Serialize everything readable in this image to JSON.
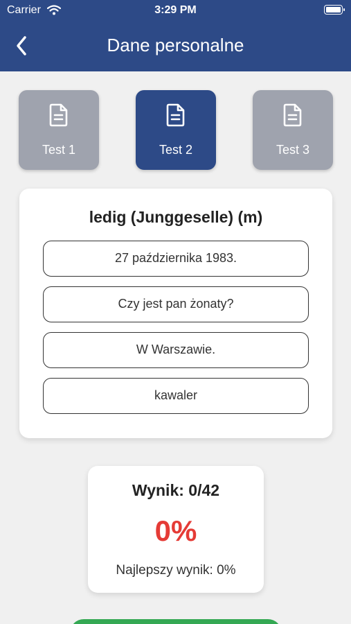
{
  "status_bar": {
    "carrier": "Carrier",
    "time": "3:29 PM"
  },
  "header": {
    "title": "Dane personalne",
    "back_icon": "chevron-left-icon"
  },
  "tabs": [
    {
      "label": "Test 1",
      "icon": "document-icon",
      "active": false
    },
    {
      "label": "Test 2",
      "icon": "document-icon",
      "active": true
    },
    {
      "label": "Test 3",
      "icon": "document-icon",
      "active": false
    }
  ],
  "quiz": {
    "question": "ledig (Junggeselle) (m)",
    "answers": [
      "27 października 1983.",
      "Czy jest pan żonaty?",
      "W Warszawie.",
      "kawaler"
    ]
  },
  "score": {
    "title": "Wynik: 0/42",
    "percent": "0%",
    "best": "Najlepszy wynik: 0%"
  },
  "colors": {
    "primary": "#2d4a87",
    "inactive_tab": "#9fa3ae",
    "score_red": "#e53b36",
    "button_green": "#34a853",
    "background": "#f0f0f0"
  }
}
